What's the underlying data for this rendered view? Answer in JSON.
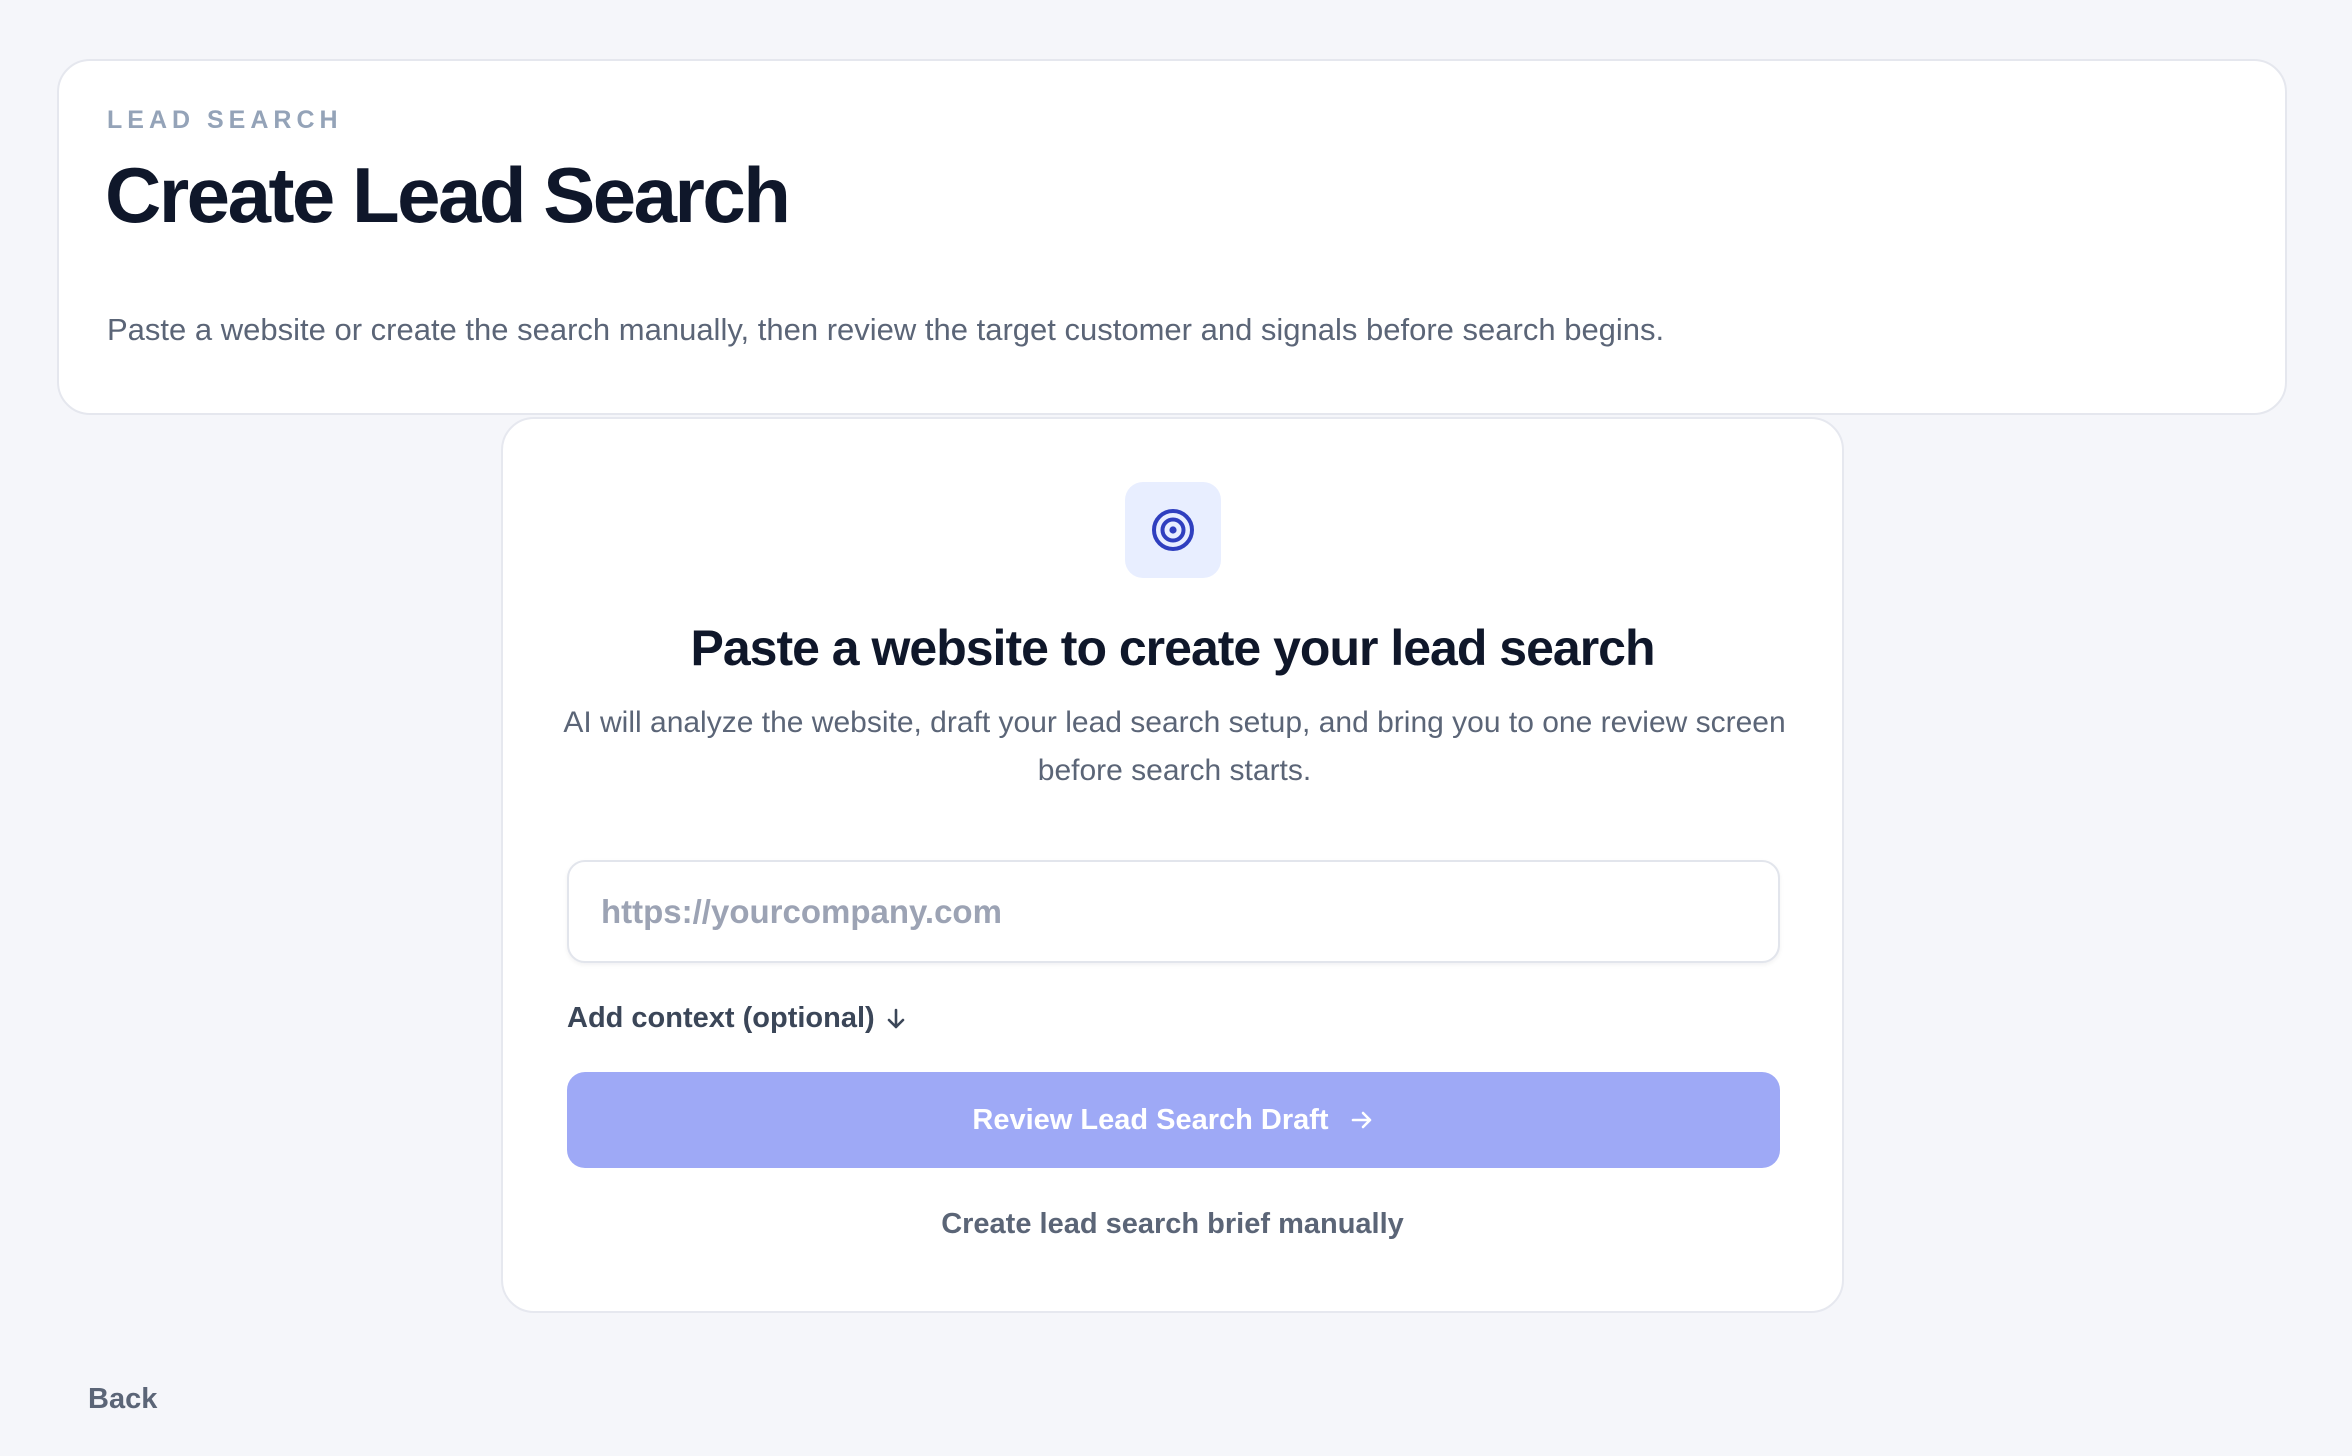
{
  "header": {
    "eyebrow": "LEAD SEARCH",
    "title": "Create Lead Search",
    "subtitle": "Paste a website or create the search manually, then review the target customer and signals before search begins."
  },
  "card": {
    "icon": "target-icon",
    "heading": "Paste a website to create your lead search",
    "description": "AI will analyze the website, draft your lead search setup, and bring you to one review screen before search starts.",
    "url_input": {
      "value": "",
      "placeholder": "https://yourcompany.com"
    },
    "context_toggle_label": "Add context (optional)",
    "primary_button_label": "Review Lead Search Draft",
    "secondary_link_label": "Create lead search brief manually"
  },
  "footer": {
    "back_label": "Back"
  },
  "colors": {
    "background": "#f5f6fa",
    "primary_disabled": "#9ea9f6",
    "icon_accent": "#2f3fbf",
    "icon_tile": "#e8eeff",
    "muted_text": "#5b6577"
  }
}
